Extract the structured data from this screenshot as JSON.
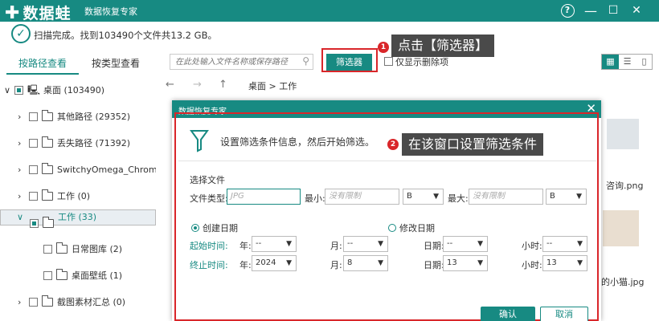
{
  "app": {
    "logo_text": "数据蛙",
    "title": "数据恢复专家",
    "help_glyph": "?",
    "minimize_glyph": "—",
    "maximize_glyph": "☐",
    "close_glyph": "✕"
  },
  "status": {
    "text": "扫描完成。找到103490个文件共13.2 GB。"
  },
  "left_tabs": {
    "by_path": "按路径查看",
    "by_type": "按类型查看"
  },
  "tree": [
    {
      "label": "桌面 (103490)"
    },
    {
      "label": "其他路径 (29352)"
    },
    {
      "label": "丢失路径 (71392)"
    },
    {
      "label": "SwitchyOmega_Chromium"
    },
    {
      "label": "工作 (0)"
    },
    {
      "label": "工作 (33)"
    },
    {
      "label": "日常图库 (2)"
    },
    {
      "label": "桌面壁纸 (1)"
    },
    {
      "label": "截图素材汇总 (0)"
    }
  ],
  "toolbar": {
    "search_placeholder": "在此处输入文件名称或保存路径",
    "filter_label": "筛选器",
    "show_deleted_label": "仅显示删除项"
  },
  "nav": {
    "back": "←",
    "forward": "→",
    "up": "↑",
    "breadcrumb": "桌面 > 工作"
  },
  "callouts": {
    "step1": "1",
    "step1_text": "点击【筛选器】",
    "step2": "2",
    "step2_text": "在该窗口设置筛选条件"
  },
  "background_files": {
    "file1": "咨询.png",
    "file2": "的小猫.jpg"
  },
  "dialog": {
    "title": "数据恢复专家",
    "close_glyph": "✕",
    "header": "设置筛选条件信息，然后开始筛选。",
    "select_file_label": "选择文件",
    "file_type_label": "文件类型:",
    "file_type_placeholder": "JPG",
    "min_label": "最小:",
    "min_placeholder": "没有限制",
    "min_unit": "B",
    "max_label": "最大:",
    "max_placeholder": "没有限制",
    "max_unit": "B",
    "created_date_label": "创建日期",
    "modified_date_label": "修改日期",
    "start_time_label": "起始时间:",
    "end_time_label": "终止时间:",
    "year_label": "年:",
    "month_label": "月:",
    "day_label": "日期:",
    "hour_label": "小时:",
    "start": {
      "year": "--",
      "month": "--",
      "day": "--",
      "hour": "--"
    },
    "end": {
      "year": "2024",
      "month": "8",
      "day": "13",
      "hour": "13"
    },
    "ok_label": "确认",
    "cancel_label": "取消"
  },
  "colors": {
    "accent": "#178a82",
    "highlight_red": "#d9262a",
    "callout_bg": "#4a4a4a"
  }
}
